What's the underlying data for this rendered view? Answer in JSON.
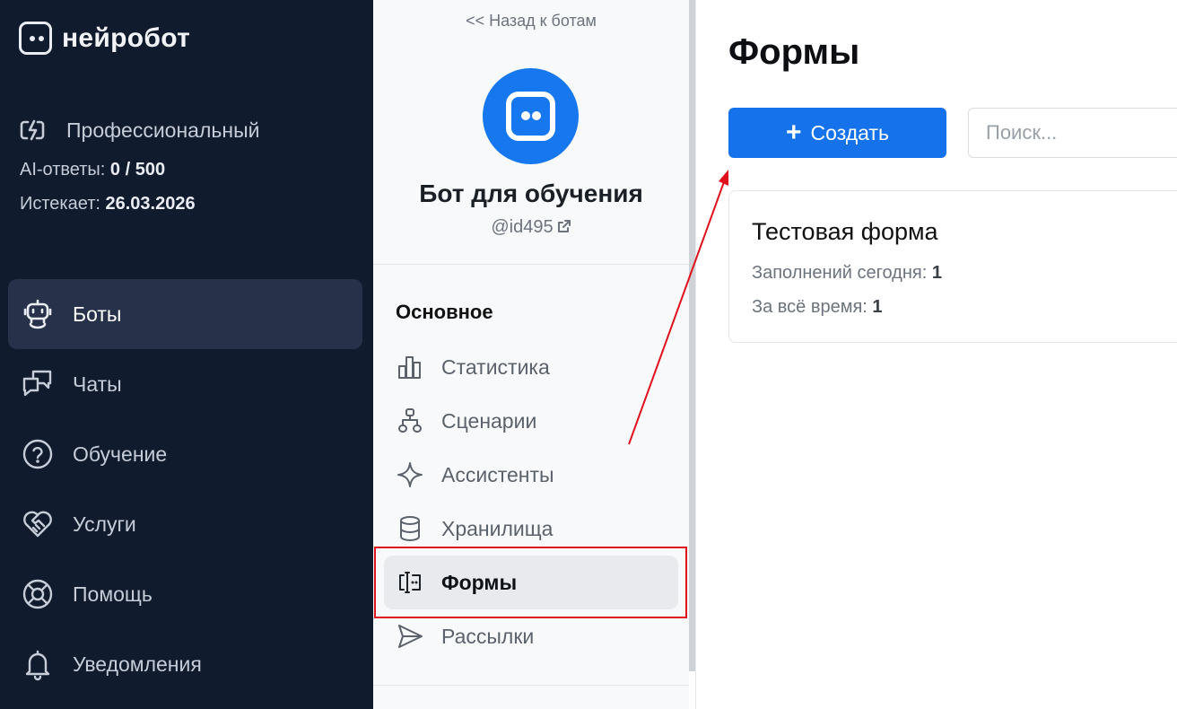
{
  "brand": {
    "name": "нейробот"
  },
  "plan": {
    "name": "Профессиональный",
    "ai_label": "AI-ответы:",
    "ai_value": "0 / 500",
    "expires_label": "Истекает:",
    "expires_value": "26.03.2026"
  },
  "nav": [
    {
      "label": "Боты",
      "icon": "robot-icon",
      "active": true
    },
    {
      "label": "Чаты",
      "icon": "chats-icon"
    },
    {
      "label": "Обучение",
      "icon": "question-circle-icon"
    },
    {
      "label": "Услуги",
      "icon": "heart-handshake-icon"
    },
    {
      "label": "Помощь",
      "icon": "lifebuoy-icon"
    },
    {
      "label": "Уведомления",
      "icon": "bell-icon"
    }
  ],
  "bot": {
    "back_link": "<< Назад к ботам",
    "name": "Бот для обучения",
    "handle": "@id495"
  },
  "menu": {
    "section": "Основное",
    "items": [
      {
        "label": "Статистика",
        "icon": "bar-chart-icon"
      },
      {
        "label": "Сценарии",
        "icon": "sitemap-icon"
      },
      {
        "label": "Ассистенты",
        "icon": "sparkle-icon"
      },
      {
        "label": "Хранилища",
        "icon": "database-icon"
      },
      {
        "label": "Формы",
        "icon": "form-input-icon",
        "active": true
      },
      {
        "label": "Рассылки",
        "icon": "send-icon"
      }
    ]
  },
  "main": {
    "title": "Формы",
    "create_label": "Создать",
    "search_placeholder": "Поиск...",
    "card": {
      "title": "Тестовая форма",
      "today_label": "Заполнений сегодня:",
      "today_value": "1",
      "total_label": "За всё время:",
      "total_value": "1"
    }
  },
  "colors": {
    "accent": "#1672ea",
    "sidebar": "#111b2e",
    "annotation": "#e0101c"
  }
}
